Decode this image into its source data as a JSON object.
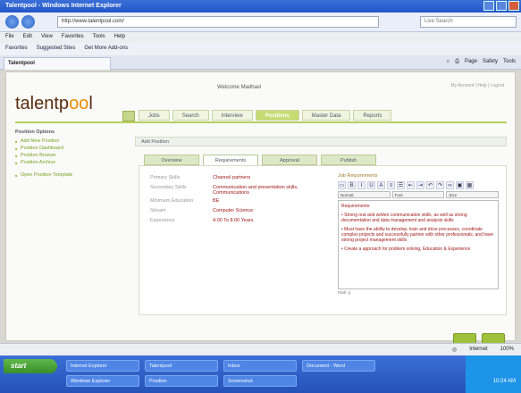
{
  "window": {
    "title": "Talentpool - Windows Internet Explorer"
  },
  "browser": {
    "url": "http://www.talentpool.com/",
    "search_placeholder": "Live Search",
    "menu": [
      "File",
      "Edit",
      "View",
      "Favorites",
      "Tools",
      "Help"
    ],
    "favorites": [
      "Favorites",
      "Suggested Sites",
      "Get More Add-ons"
    ],
    "tab_title": "Talentpool",
    "commands": [
      "Page",
      "Safety",
      "Tools"
    ]
  },
  "page": {
    "logo_prefix": "talentp",
    "logo_accent": "oo",
    "logo_suffix": "l",
    "welcome": "Welcome Madhavi",
    "top_links": "My Account | Help | Logout",
    "nav_tabs": [
      "Jobs",
      "Search",
      "Interview",
      "Positions",
      "Master Data",
      "Reports"
    ],
    "active_nav": 3
  },
  "sidebar": {
    "heading": "Position Options",
    "links": [
      "Add New Position",
      "Position Dashboard",
      "Position Browse",
      "Position Archive"
    ],
    "extra_link": "Open Position Template"
  },
  "breadcrumb": "Add Position",
  "form_tabs": [
    "Overview",
    "Requirements",
    "Approval",
    "Publish"
  ],
  "active_form_tab": 1,
  "fields": [
    {
      "label": "Primary Skills",
      "value": "Channel partners"
    },
    {
      "label": "Secondary Skills",
      "value": "Communication and presentation skills, Communications"
    },
    {
      "label": "Minimum Education",
      "value": "BE"
    },
    {
      "label": "Stream",
      "value": "Computer Science"
    },
    {
      "label": "Experience",
      "value": "4.00 To 8.00 Years"
    }
  ],
  "editor": {
    "label": "Job Requirements",
    "font_select": "Font",
    "format_select": "Normal",
    "size_select": "Size",
    "heading": "Requirements:",
    "items": [
      "Strong oral and written communication skills, as well as strong documentation and data management and analysis skills",
      "Must have the ability to develop, train and drive processes, coordinate complex projects and successfully partner with other professionals, and have strong project management skills",
      "Create a approach for problem solving, Education & Experience"
    ],
    "path": "Path: p"
  },
  "statusbar": {
    "zone": "Internet",
    "zoom": "100%"
  },
  "taskbar": {
    "start": "start",
    "tasks_row1": [
      "Internet Explorer",
      "Talentpool",
      "Inbox",
      "Document - Word"
    ],
    "tasks_row2": [
      "Windows Explorer",
      "Position",
      "Screenshot"
    ],
    "clock": "10:24 AM"
  },
  "colors": {
    "accent_green": "#9fc23c",
    "logo_brown": "#5a2c0e",
    "logo_orange": "#f08c00",
    "value_red": "#a01818"
  }
}
